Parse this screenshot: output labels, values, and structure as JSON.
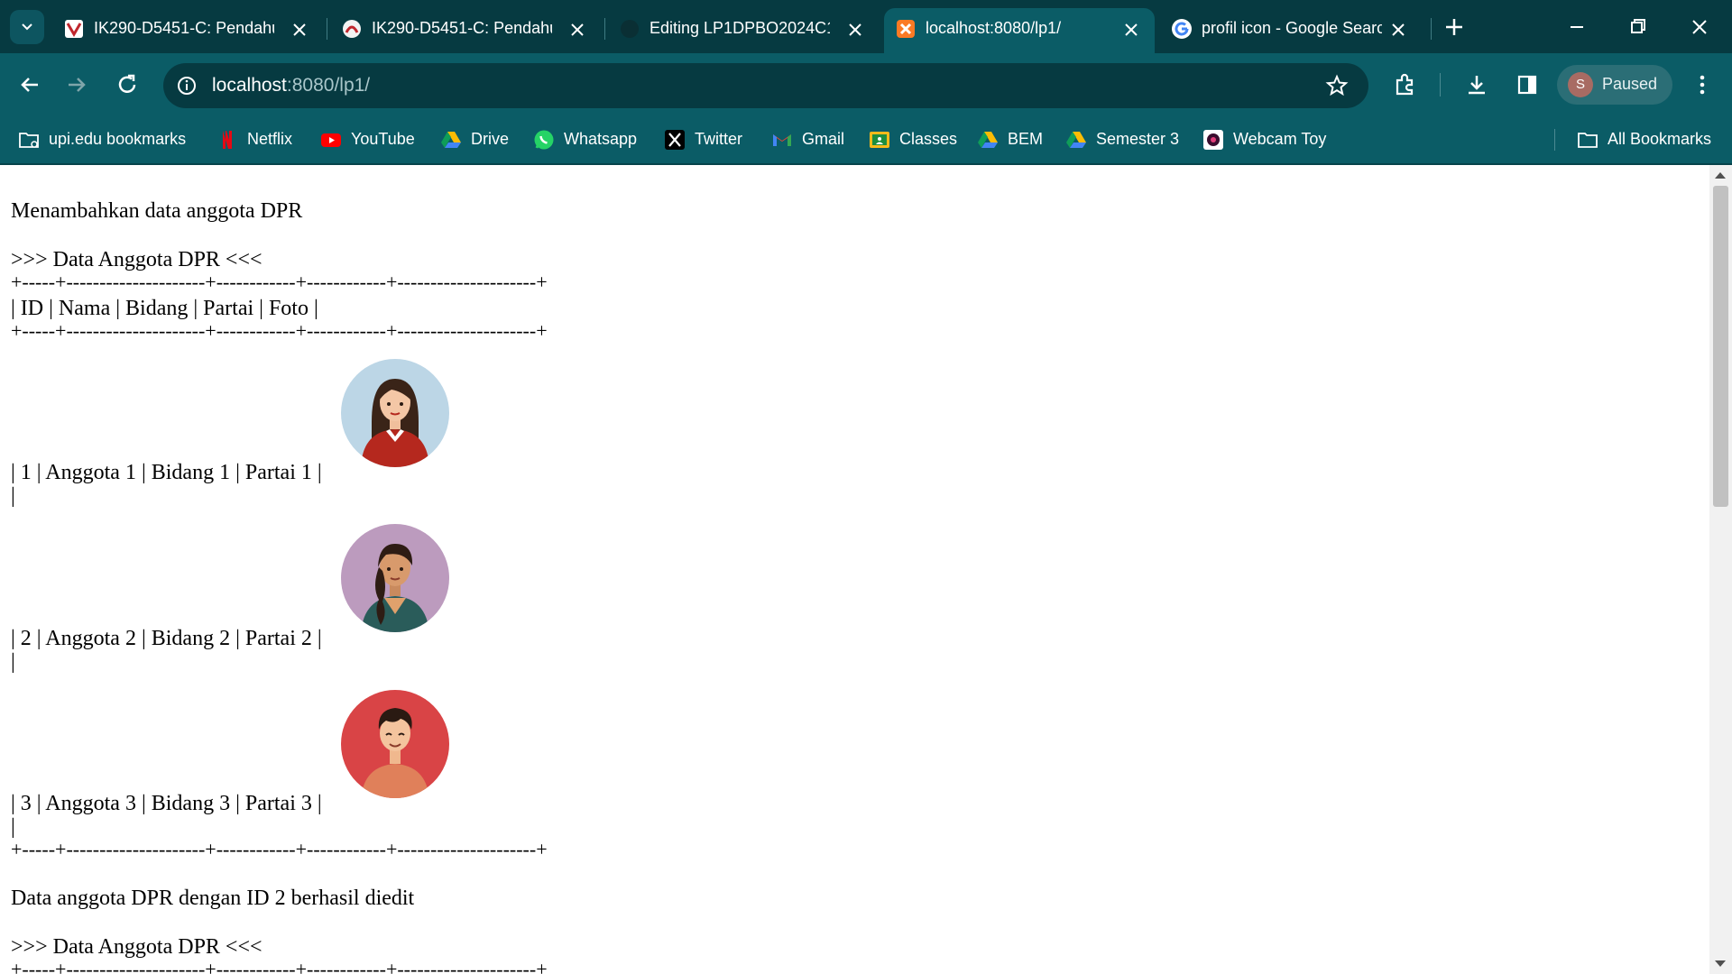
{
  "browser": {
    "tabs": [
      {
        "title": "IK290-D5451-C: Pendahu",
        "icon": "upi-icon",
        "active": false
      },
      {
        "title": "IK290-D5451-C: Pendahu",
        "icon": "moodle-icon",
        "active": false
      },
      {
        "title": "Editing LP1DPBO2024C1/",
        "icon": "github-icon",
        "active": false
      },
      {
        "title": "localhost:8080/lp1/",
        "icon": "xampp-icon",
        "active": true
      },
      {
        "title": "profil icon - Google Searc",
        "icon": "google-icon",
        "active": false
      }
    ],
    "address": {
      "host": "localhost",
      "path": ":8080/lp1/"
    },
    "profile": {
      "initial": "S",
      "label": "Paused"
    },
    "bookmarks": [
      {
        "label": "upi.edu bookmarks",
        "icon": "folder-icon"
      },
      {
        "label": "Netflix",
        "icon": "netflix-icon"
      },
      {
        "label": "YouTube",
        "icon": "youtube-icon"
      },
      {
        "label": "Drive",
        "icon": "drive-icon"
      },
      {
        "label": "Whatsapp",
        "icon": "whatsapp-icon"
      },
      {
        "label": "Twitter",
        "icon": "x-icon"
      },
      {
        "label": "Gmail",
        "icon": "gmail-icon"
      },
      {
        "label": "Classes",
        "icon": "classroom-icon"
      },
      {
        "label": "BEM",
        "icon": "drive-icon"
      },
      {
        "label": "Semester 3",
        "icon": "drive-icon"
      },
      {
        "label": "Webcam Toy",
        "icon": "webcam-icon"
      }
    ],
    "all_bookmarks": "All Bookmarks"
  },
  "page": {
    "add_message": "Menambahkan data anggota DPR",
    "heading": ">>> Data Anggota DPR <<<",
    "border": "+-----+---------------------+------------+------------+---------------------+",
    "header_row": "| ID | Nama | Bidang | Partai | Foto |",
    "rows": [
      {
        "text": "| 1 | Anggota 1 | Bidang 1 | Partai 1 |",
        "tail": "|",
        "avatar": "woman-long-hair-avatar",
        "bg": "#bcd6e6"
      },
      {
        "text": "| 2 | Anggota 2 | Bidang 2 | Partai 2 |",
        "tail": "|",
        "avatar": "woman-braid-avatar",
        "bg": "#bc9bbe"
      },
      {
        "text": "| 3 | Anggota 3 | Bidang 3 | Partai 3 |",
        "tail": "|",
        "avatar": "man-short-hair-avatar",
        "bg": "#d94446"
      }
    ],
    "edit_message": "Data anggota DPR dengan ID 2 berhasil diedit",
    "heading2": ">>> Data Anggota DPR <<<"
  },
  "colors": {
    "tabbar": "#063a41",
    "toolbar": "#0b5c66",
    "host_text": "#ffffff",
    "path_text": "#a9c6ca"
  }
}
